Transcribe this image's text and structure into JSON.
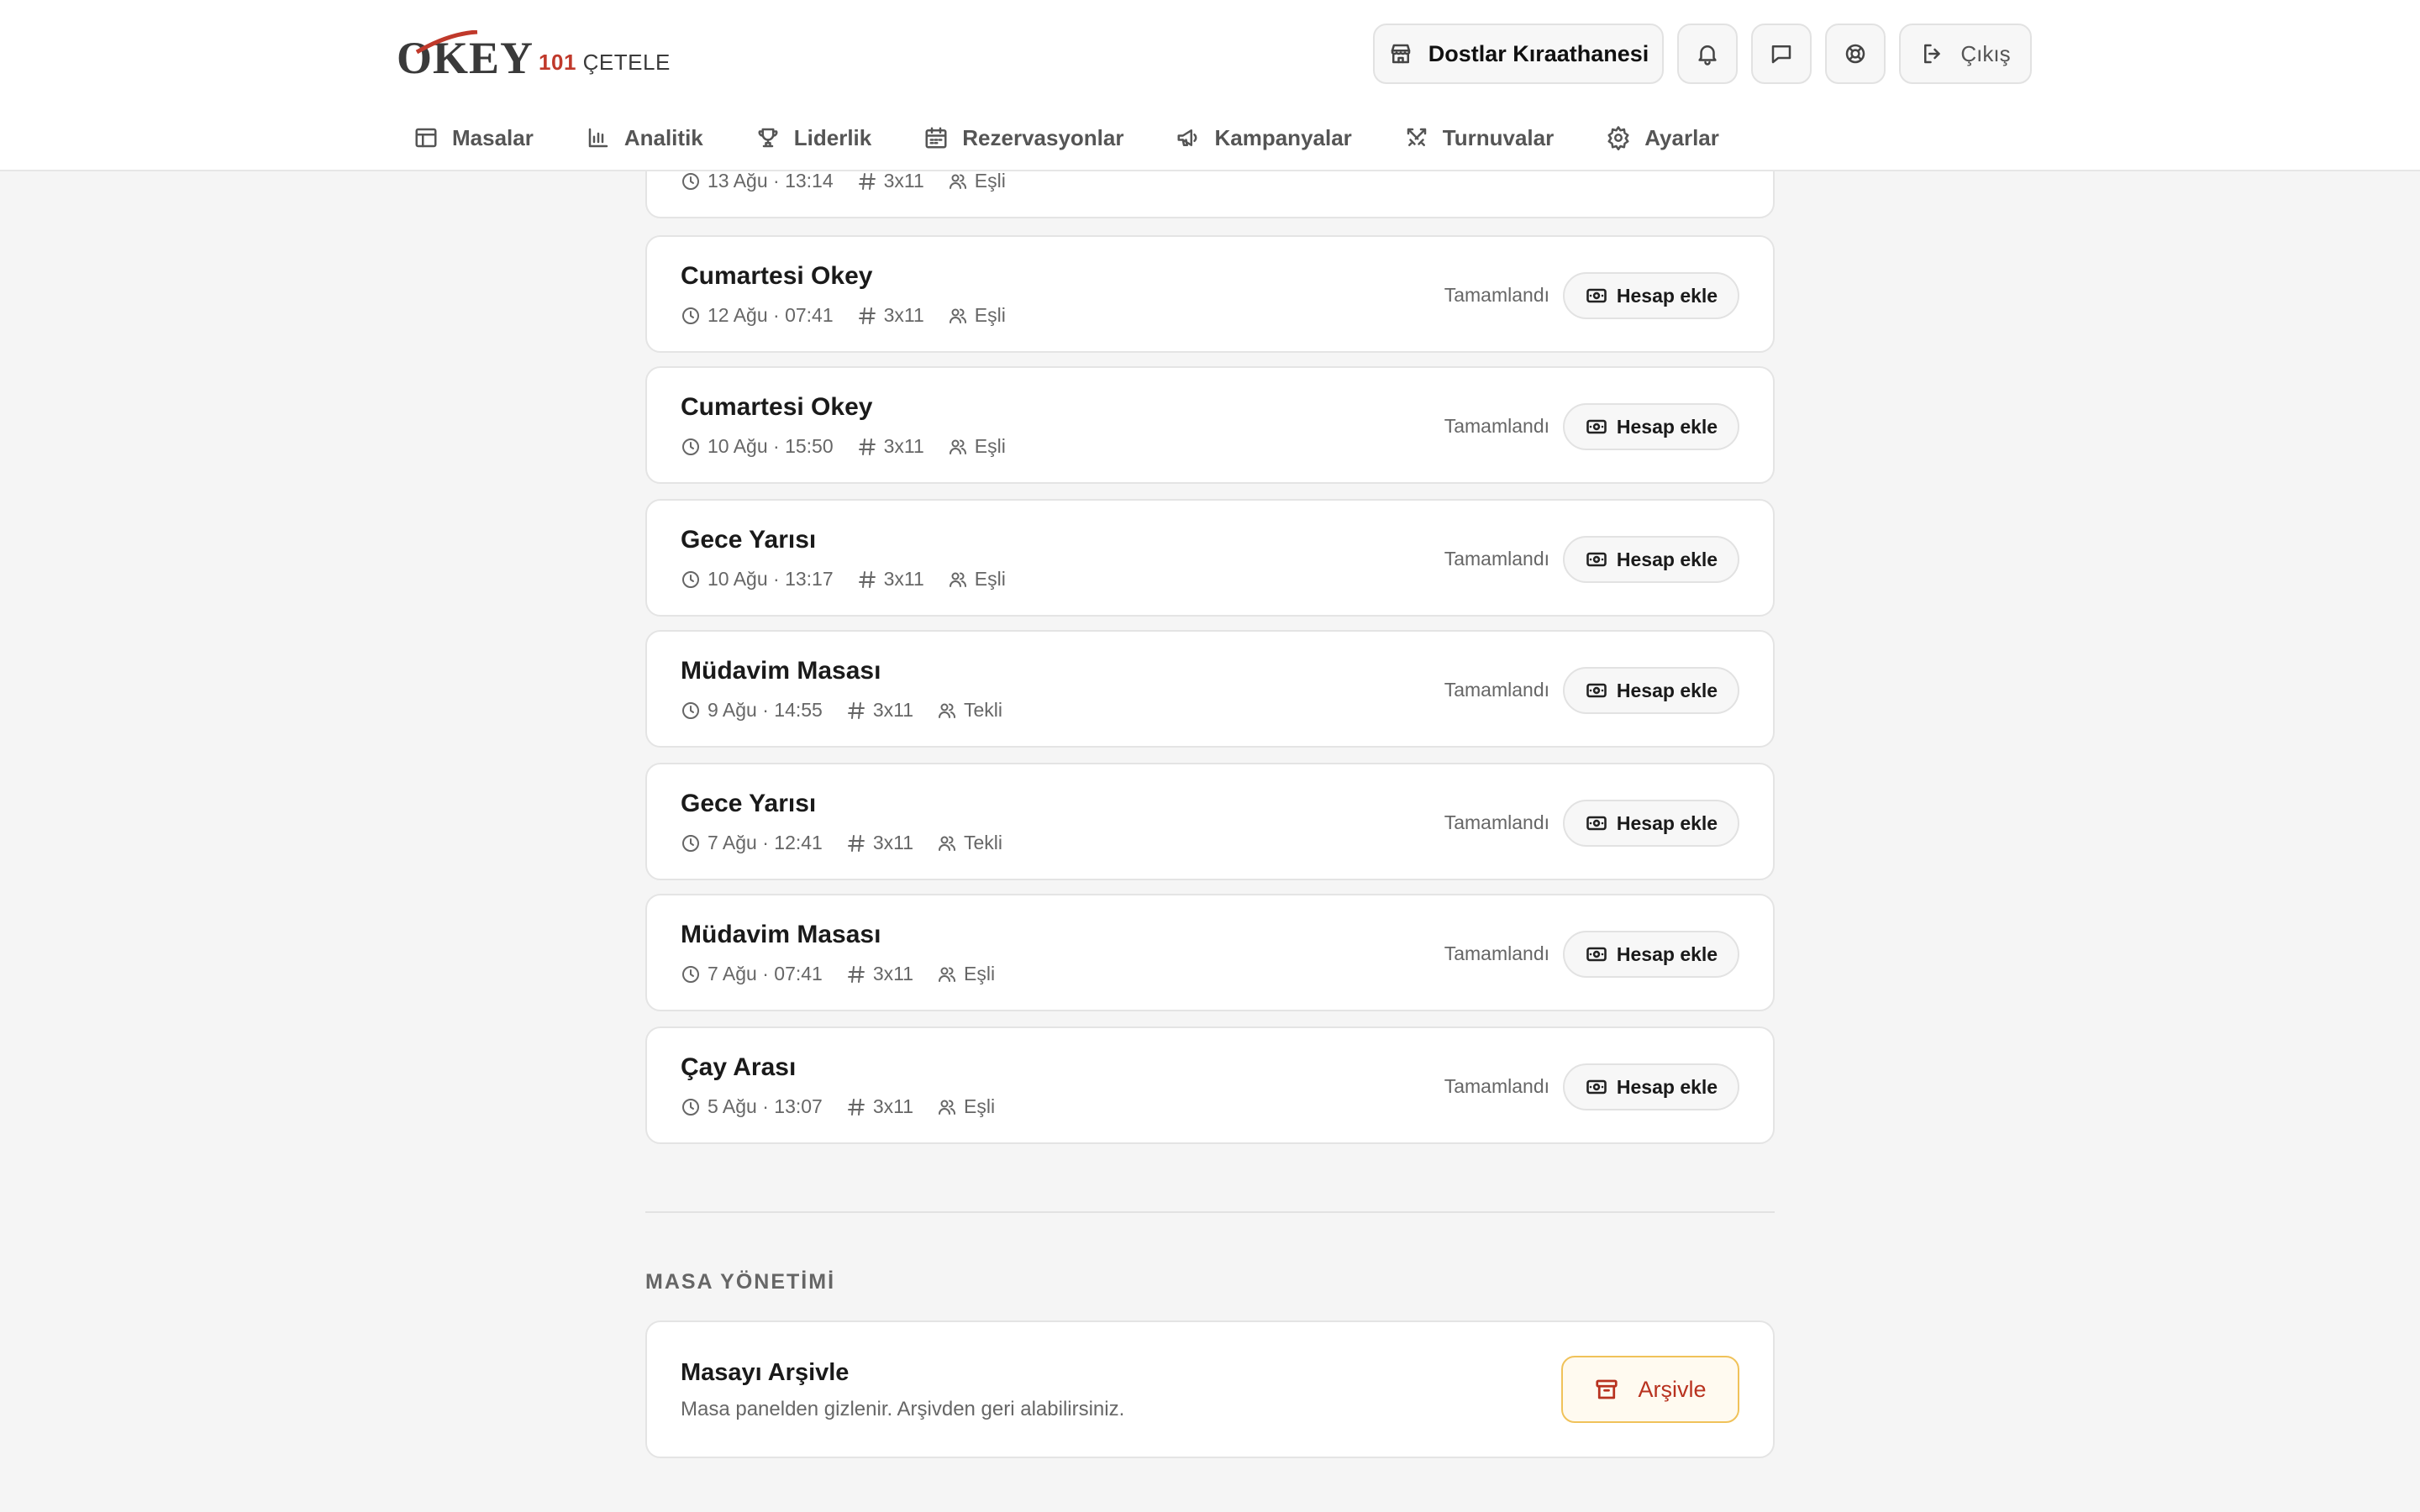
{
  "header": {
    "logo": {
      "main": "OKEY",
      "sub_highlight": "101",
      "sub": "ÇETELE"
    },
    "venue_name": "Dostlar Kıraathanesi",
    "logout_label": "Çıkış",
    "icons": [
      "store-icon",
      "bell-icon",
      "chat-icon",
      "support-icon",
      "logout-icon"
    ]
  },
  "nav": {
    "items": [
      {
        "label": "Masalar",
        "icon": "table-icon"
      },
      {
        "label": "Analitik",
        "icon": "chart-icon"
      },
      {
        "label": "Liderlik",
        "icon": "trophy-icon"
      },
      {
        "label": "Rezervasyonlar",
        "icon": "calendar-icon"
      },
      {
        "label": "Kampanyalar",
        "icon": "megaphone-icon"
      },
      {
        "label": "Turnuvalar",
        "icon": "swords-icon"
      },
      {
        "label": "Ayarlar",
        "icon": "gear-icon"
      }
    ]
  },
  "games": [
    {
      "title": "",
      "datetime": "13 Ağu · 13:14",
      "format": "3x11",
      "mode": "Eşli",
      "status": "",
      "action": ""
    },
    {
      "title": "Cumartesi Okey",
      "datetime": "12 Ağu · 07:41",
      "format": "3x11",
      "mode": "Eşli",
      "status": "Tamamlandı",
      "action": "Hesap ekle"
    },
    {
      "title": "Cumartesi Okey",
      "datetime": "10 Ağu · 15:50",
      "format": "3x11",
      "mode": "Eşli",
      "status": "Tamamlandı",
      "action": "Hesap ekle"
    },
    {
      "title": "Gece Yarısı",
      "datetime": "10 Ağu · 13:17",
      "format": "3x11",
      "mode": "Eşli",
      "status": "Tamamlandı",
      "action": "Hesap ekle"
    },
    {
      "title": "Müdavim Masası",
      "datetime": "9 Ağu · 14:55",
      "format": "3x11",
      "mode": "Tekli",
      "status": "Tamamlandı",
      "action": "Hesap ekle"
    },
    {
      "title": "Gece Yarısı",
      "datetime": "7 Ağu · 12:41",
      "format": "3x11",
      "mode": "Tekli",
      "status": "Tamamlandı",
      "action": "Hesap ekle"
    },
    {
      "title": "Müdavim Masası",
      "datetime": "7 Ağu · 07:41",
      "format": "3x11",
      "mode": "Eşli",
      "status": "Tamamlandı",
      "action": "Hesap ekle"
    },
    {
      "title": "Çay Arası",
      "datetime": "5 Ağu · 13:07",
      "format": "3x11",
      "mode": "Eşli",
      "status": "Tamamlandı",
      "action": "Hesap ekle"
    }
  ],
  "management": {
    "section_title": "MASA YÖNETİMİ",
    "archive_title": "Masayı Arşivle",
    "archive_desc": "Masa panelden gizlenir. Arşivden geri alabilirsiniz.",
    "archive_button": "Arşivle",
    "accent_color": "#b8321f"
  }
}
